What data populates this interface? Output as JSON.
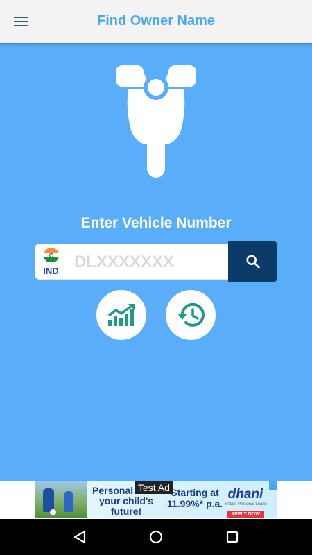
{
  "appbar": {
    "title": "Find Owner Name",
    "menu_icon": "hamburger-menu-icon"
  },
  "main": {
    "hero_icon": "scooter-icon",
    "prompt": "Enter Vehicle Number",
    "country_code": "IND",
    "vehicle_input": {
      "value": "",
      "placeholder": "DLXXXXXXX"
    },
    "search_icon": "search-icon",
    "action_buttons": [
      {
        "icon": "trending-chart-icon"
      },
      {
        "icon": "history-icon"
      }
    ]
  },
  "ad": {
    "label": "Test Ad",
    "text_left": "Personal lo for your child's future!",
    "text_mid": "Starting at 11.99%* p.a.",
    "brand": "dhani",
    "brand_sub": "Instant Personal Loans",
    "cta": "APPLY NOW"
  },
  "navbar": {
    "items": [
      {
        "icon": "back-icon"
      },
      {
        "icon": "home-icon"
      },
      {
        "icon": "recents-icon"
      }
    ]
  },
  "colors": {
    "appbar_bg": "#f3f3f3",
    "title": "#4aa8f2",
    "main_bg": "#5aadf8",
    "search_button": "#0b3b66",
    "icon_green": "#1f9a85"
  }
}
